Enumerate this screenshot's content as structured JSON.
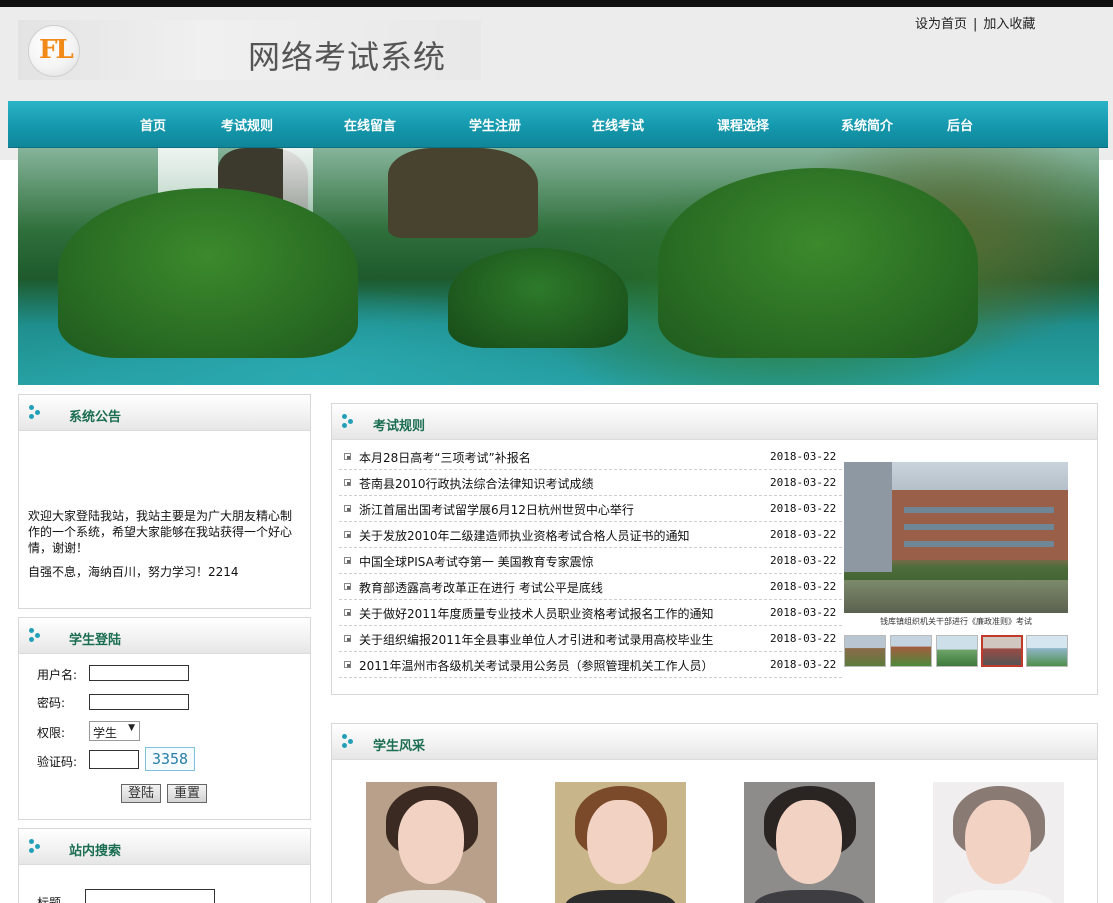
{
  "header": {
    "logo_letters": "FL",
    "site_title": "网络考试系统",
    "links": [
      "设为首页",
      "加入收藏"
    ],
    "link_separator": "|"
  },
  "nav": {
    "items": [
      "首页",
      "考试规则",
      "在线留言",
      "学生注册",
      "在线考试",
      "课程选择",
      "系统简介",
      "后台"
    ]
  },
  "notice": {
    "title": "系统公告",
    "text": "欢迎大家登陆我站，我站主要是为广大朋友精心制作的一个系统，希望大家能够在我站获得一个好心情，谢谢！",
    "motto": "自强不息，海纳百川，努力学习！2214"
  },
  "login": {
    "title": "学生登陆",
    "username_label": "用户名:",
    "username_value": "",
    "password_label": "密码:",
    "password_value": "",
    "role_label": "权限:",
    "role_selected": "学生",
    "captcha_label": "验证码:",
    "captcha_value": "",
    "captcha_code": "3358",
    "login_button": "登陆",
    "reset_button": "重置"
  },
  "search": {
    "title": "站内搜索",
    "title_label": "标题",
    "title_value": ""
  },
  "rules": {
    "title": "考试规则",
    "items": [
      {
        "title": "本月28日高考“三项考试”补报名",
        "date": "2018-03-22"
      },
      {
        "title": "苍南县2010行政执法综合法律知识考试成绩",
        "date": "2018-03-22"
      },
      {
        "title": "浙江首届出国考试留学展6月12日杭州世贸中心举行",
        "date": "2018-03-22"
      },
      {
        "title": "关于发放2010年二级建造师执业资格考试合格人员证书的通知",
        "date": "2018-03-22"
      },
      {
        "title": "中国全球PISA考试夺第一 美国教育专家震惊",
        "date": "2018-03-22"
      },
      {
        "title": "教育部透露高考改革正在进行 考试公平是底线",
        "date": "2018-03-22"
      },
      {
        "title": "关于做好2011年度质量专业技术人员职业资格考试报名工作的通知",
        "date": "2018-03-22"
      },
      {
        "title": "关于组织编报2011年全县事业单位人才引进和考试录用高校毕业生",
        "date": "2018-03-22"
      },
      {
        "title": "2011年温州市各级机关考试录用公务员（参照管理机关工作人员）",
        "date": "2018-03-22"
      }
    ],
    "photo_caption": "钱库镇组织机关干部进行《廉政准则》考试"
  },
  "students": {
    "title": "学生风采"
  },
  "colors": {
    "nav": "#1598ad",
    "panel_title": "#1b6e51",
    "accent_dots": "#23a0b7",
    "captcha_text": "#2a7fa8"
  }
}
